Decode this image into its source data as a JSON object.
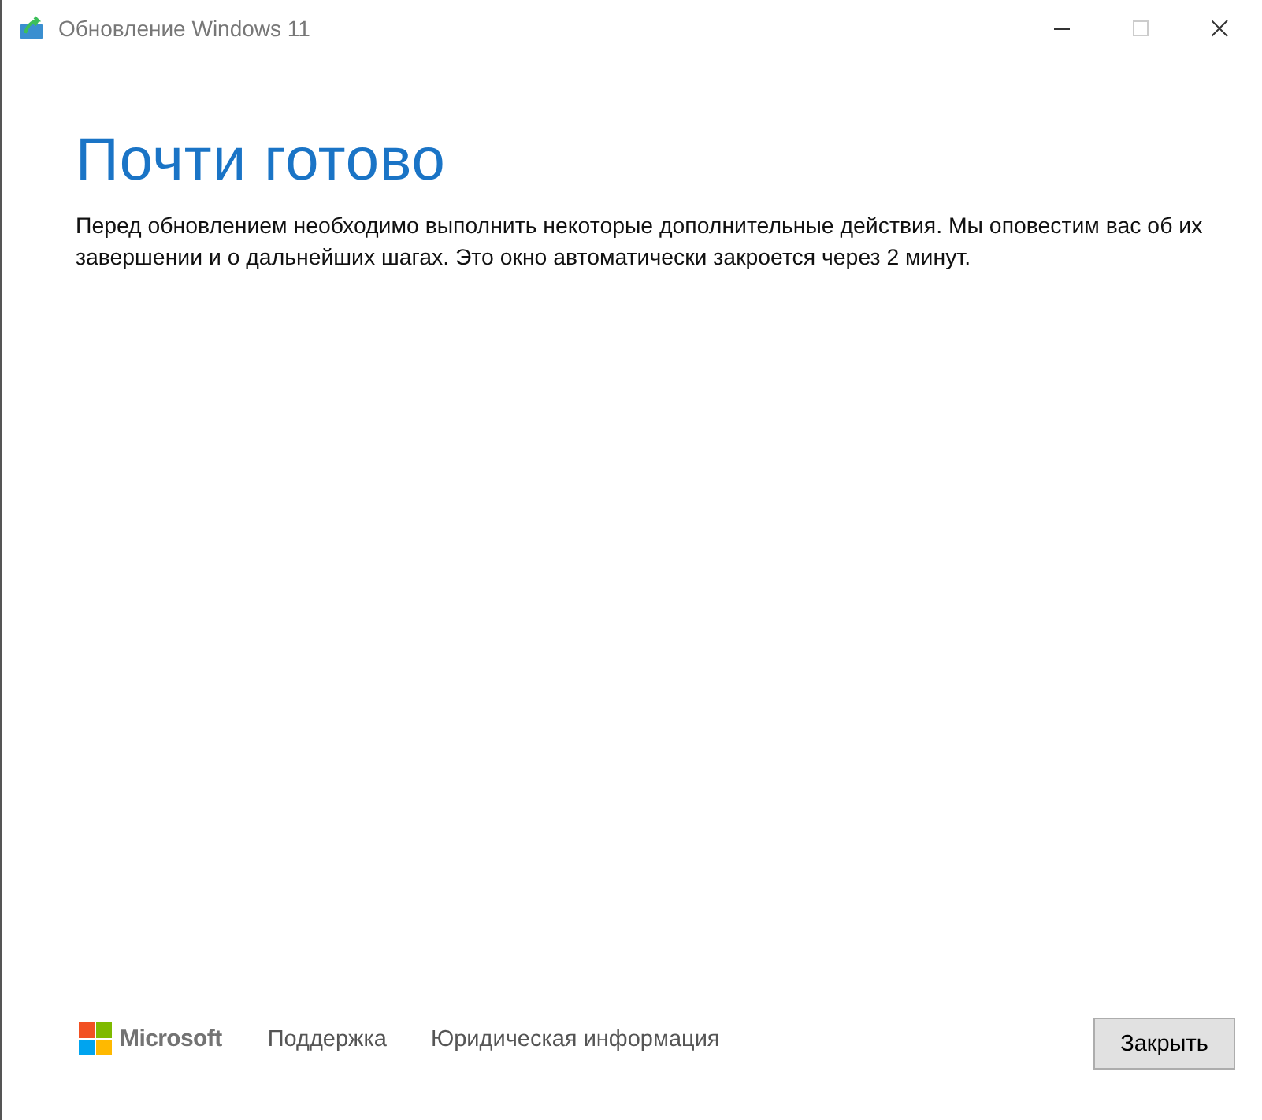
{
  "window": {
    "title": "Обновление Windows 11",
    "controls": [
      {
        "kind": "minimize",
        "disabled": false
      },
      {
        "kind": "maximize",
        "disabled": true
      },
      {
        "kind": "close",
        "disabled": false
      }
    ]
  },
  "heading": "Почти готово",
  "message": "Перед обновлением необходимо выполнить некоторые дополнительные действия. Мы оповестим вас об их завершении и о дальнейших шагах. Это окно автоматически закроется через 2 минут.",
  "footer": {
    "brand": "Microsoft",
    "links": [
      "Поддержка",
      "Юридическая информация"
    ],
    "button": "Закрыть"
  }
}
